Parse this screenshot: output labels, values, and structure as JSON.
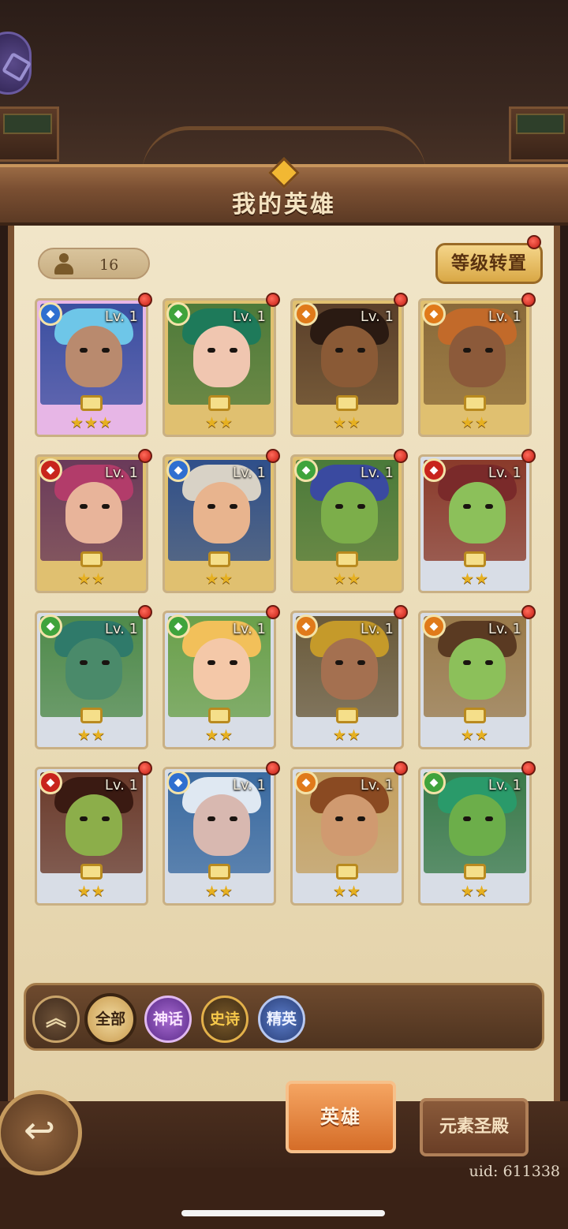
{
  "header": {
    "title": "我的英雄"
  },
  "hero_count": "16",
  "reset_button": "等级转置",
  "cards": [
    {
      "level": "Lv. 1",
      "element": "water",
      "elem_color": "#2f6fd0",
      "stars": "★★★",
      "bg": "#3a4fa0",
      "hair": "#6ec6e8",
      "skin": "#b98a6e",
      "frame": "#e7b6e6"
    },
    {
      "level": "Lv. 1",
      "element": "wind",
      "elem_color": "#3fa33c",
      "stars": "★★",
      "bg": "#4d7a3a",
      "hair": "#1e7a5a",
      "skin": "#f0c6b0",
      "frame": "#e0c070"
    },
    {
      "level": "Lv. 1",
      "element": "earth",
      "elem_color": "#e07a1a",
      "stars": "★★",
      "bg": "#5a3f2a",
      "hair": "#2a1a12",
      "skin": "#8a5a36",
      "frame": "#e0c070"
    },
    {
      "level": "Lv. 1",
      "element": "earth",
      "elem_color": "#e07a1a",
      "stars": "★★",
      "bg": "#8a6a3a",
      "hair": "#c26a2a",
      "skin": "#8c5a3a",
      "frame": "#e0c070"
    },
    {
      "level": "Lv. 1",
      "element": "fire",
      "elem_color": "#c8241c",
      "stars": "★★",
      "bg": "#6a3a5a",
      "hair": "#b23c6a",
      "skin": "#e8b49a",
      "frame": "#e0c070"
    },
    {
      "level": "Lv. 1",
      "element": "water",
      "elem_color": "#2f6fd0",
      "stars": "★★",
      "bg": "#2f4f8a",
      "hair": "#d8d2c6",
      "skin": "#e8b48e",
      "frame": "#e0c070"
    },
    {
      "level": "Lv. 1",
      "element": "wind",
      "elem_color": "#3fa33c",
      "stars": "★★",
      "bg": "#4a7a3a",
      "hair": "#3a4aa0",
      "skin": "#7cae4a",
      "frame": "#e0c070"
    },
    {
      "level": "Lv. 1",
      "element": "fire",
      "elem_color": "#c8241c",
      "stars": "★★",
      "bg": "#8a3a2a",
      "hair": "#7a2a2a",
      "skin": "#8cc05a",
      "frame": "#d8dde6"
    },
    {
      "level": "Lv. 1",
      "element": "wind",
      "elem_color": "#3fa33c",
      "stars": "★★",
      "bg": "#4f8a4a",
      "hair": "#2f7a6a",
      "skin": "#4a8a6a",
      "frame": "#d8dde6"
    },
    {
      "level": "Lv. 1",
      "element": "wind",
      "elem_color": "#3fa33c",
      "stars": "★★",
      "bg": "#6aa04a",
      "hair": "#f2c05a",
      "skin": "#f4c8a8",
      "frame": "#d8dde6"
    },
    {
      "level": "Lv. 1",
      "element": "earth",
      "elem_color": "#e07a1a",
      "stars": "★★",
      "bg": "#6a5a3a",
      "hair": "#c59a2a",
      "skin": "#a47050",
      "frame": "#d8dde6"
    },
    {
      "level": "Lv. 1",
      "element": "earth",
      "elem_color": "#e07a1a",
      "stars": "★★",
      "bg": "#9a7a4a",
      "hair": "#5a3a22",
      "skin": "#8cc05a",
      "frame": "#d8dde6"
    },
    {
      "level": "Lv. 1",
      "element": "fire",
      "elem_color": "#c8241c",
      "stars": "★★",
      "bg": "#6a3a2a",
      "hair": "#3a1a12",
      "skin": "#8cae4a",
      "frame": "#d8dde6"
    },
    {
      "level": "Lv. 1",
      "element": "water",
      "elem_color": "#2f6fd0",
      "stars": "★★",
      "bg": "#3a6aa0",
      "hair": "#dfe8f2",
      "skin": "#d8b8b0",
      "frame": "#d8dde6"
    },
    {
      "level": "Lv. 1",
      "element": "earth",
      "elem_color": "#e07a1a",
      "stars": "★★",
      "bg": "#c4a060",
      "hair": "#8a4a22",
      "skin": "#d09a70",
      "frame": "#d8dde6"
    },
    {
      "level": "Lv. 1",
      "element": "wind",
      "elem_color": "#3fa33c",
      "stars": "★★",
      "bg": "#3a7a4a",
      "hair": "#2a9a6a",
      "skin": "#6cae4a",
      "frame": "#d8dde6"
    }
  ],
  "filters": {
    "collapse": "︽",
    "all": "全部",
    "myth": "神话",
    "epic": "史诗",
    "elite": "精英"
  },
  "tabs": {
    "hero": "英雄",
    "temple": "元素圣殿"
  },
  "back_icon": "↩",
  "uid": "uid: 611338"
}
